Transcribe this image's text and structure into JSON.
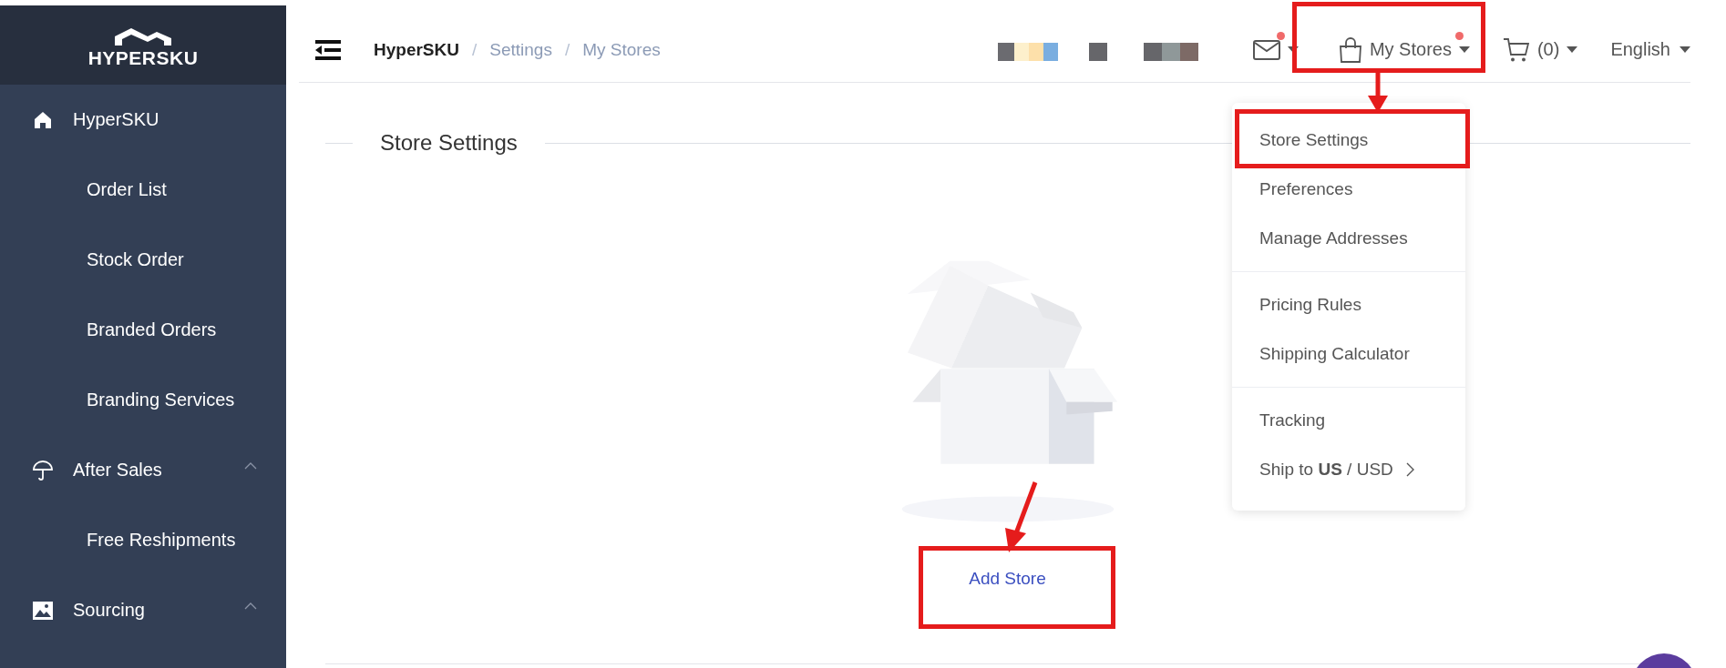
{
  "sidebar": {
    "logo": "HYPERSKU",
    "sections": [
      {
        "label": "HyperSKU",
        "kind": "home",
        "children": [
          {
            "label": "Order List"
          },
          {
            "label": "Stock Order"
          },
          {
            "label": "Branded Orders"
          },
          {
            "label": "Branding Services"
          }
        ]
      },
      {
        "label": "After Sales",
        "kind": "collapsible",
        "expanded": true,
        "children": [
          {
            "label": "Free Reshipments"
          }
        ]
      },
      {
        "label": "Sourcing",
        "kind": "collapsible",
        "expanded": true
      }
    ]
  },
  "header": {
    "breadcrumb": [
      "HyperSKU",
      "Settings",
      "My Stores"
    ],
    "separator": "/",
    "mail": {
      "unread": true
    },
    "stores": {
      "label": "My Stores",
      "unread": true
    },
    "cart": {
      "count": "(0)"
    },
    "language": "English"
  },
  "dropdown": {
    "groups": [
      [
        {
          "label": "Store Settings",
          "kind": "plain"
        },
        {
          "label": "Preferences",
          "kind": "plain"
        },
        {
          "label": "Manage Addresses",
          "kind": "plain"
        }
      ],
      [
        {
          "label": "Pricing Rules",
          "kind": "plain"
        },
        {
          "label": "Shipping Calculator",
          "kind": "plain"
        }
      ],
      [
        {
          "label": "Tracking",
          "kind": "plain"
        },
        {
          "label": "Ship to **US** / USD",
          "kind": "submenu"
        }
      ]
    ]
  },
  "content": {
    "title": "Store Settings",
    "action": "Add Store"
  }
}
